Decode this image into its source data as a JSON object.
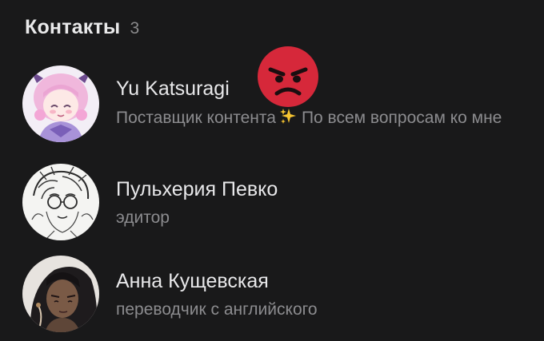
{
  "header": {
    "title": "Контакты",
    "count": "3"
  },
  "contacts": [
    {
      "name": "Yu Katsuragi",
      "status_before": "Поставщик контента",
      "status_emoji": "sparkles-icon",
      "status_after": "По всем вопросам ко мне",
      "reaction": "angry-face-emoji"
    },
    {
      "name": "Пульхерия Певко",
      "status": "эдитор"
    },
    {
      "name": "Анна Кущевская",
      "status": "переводчик с английского"
    }
  ],
  "colors": {
    "background": "#19191a",
    "text_primary": "#e8e8ea",
    "text_secondary": "#8c8c8f",
    "angry_red": "#d6283a",
    "sparkle_gold": "#f7c531"
  }
}
